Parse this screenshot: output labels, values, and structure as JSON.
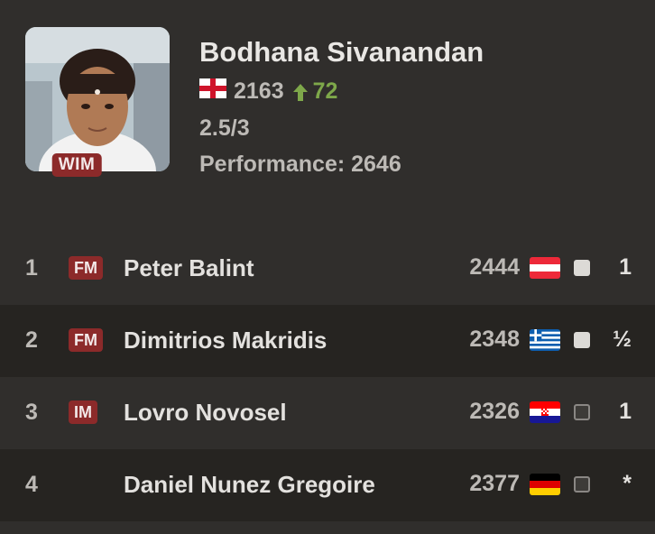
{
  "player": {
    "name": "Bodhana Sivanandan",
    "title": "WIM",
    "rating": "2163",
    "rating_change": "72",
    "score": "2.5/3",
    "performance": "Performance: 2646",
    "flag": "england-flag-icon"
  },
  "games": [
    {
      "round": "1",
      "title": "FM",
      "opponent": "Peter Balint",
      "rating": "2444",
      "flag": "austria-flag-icon",
      "color": "white",
      "result": "1"
    },
    {
      "round": "2",
      "title": "FM",
      "opponent": "Dimitrios Makridis",
      "rating": "2348",
      "flag": "greece-flag-icon",
      "color": "white",
      "result": "½"
    },
    {
      "round": "3",
      "title": "IM",
      "opponent": "Lovro Novosel",
      "rating": "2326",
      "flag": "croatia-flag-icon",
      "color": "black",
      "result": "1"
    },
    {
      "round": "4",
      "title": "",
      "opponent": "Daniel Nunez Gregoire",
      "rating": "2377",
      "flag": "germany-flag-icon",
      "color": "black",
      "result": "*"
    }
  ],
  "colors": {
    "background": "#302e2c",
    "row_alt": "#262421",
    "title_badge": "#8c2a2a",
    "gain": "#7ea84a"
  }
}
